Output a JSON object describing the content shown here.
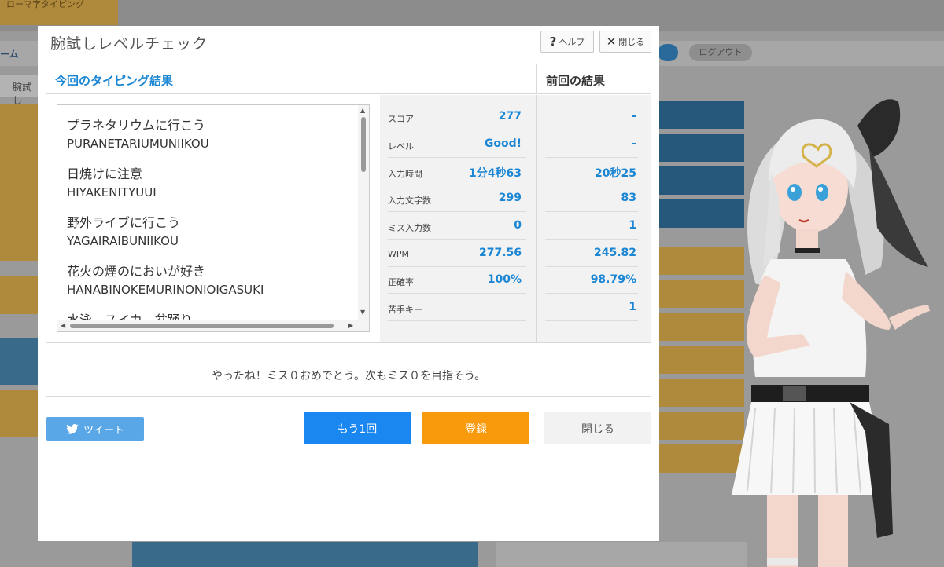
{
  "background": {
    "logo_text": "ローマ字タイピング",
    "nav_home": "ーム",
    "login": "ログアウト",
    "breadcrumb": "腕試し"
  },
  "dialog": {
    "title": "腕試しレベルチェック",
    "help_icon": "question-icon",
    "help_label": "ヘルプ",
    "close_icon": "x-icon",
    "close_label": "閉じる"
  },
  "tabs": {
    "current": "今回のタイピング結果",
    "previous": "前回の結果"
  },
  "words": [
    {
      "jp": "プラネタリウムに行こう",
      "romaji": "PURANETARIUMUNIIKOU"
    },
    {
      "jp": "日焼けに注意",
      "romaji": "HIYAKENITYUUI"
    },
    {
      "jp": "野外ライブに行こう",
      "romaji": "YAGAIRAIBUNIIKOU"
    },
    {
      "jp": "花火の煙のにおいが好き",
      "romaji": "HANABINOKEMURINONIOIGASUKI"
    },
    {
      "jp": "水泳、スイカ、盆踊り",
      "romaji": ""
    }
  ],
  "stats": [
    {
      "label": "スコア",
      "value": "277",
      "previous": "-"
    },
    {
      "label": "レベル",
      "value": "Good!",
      "previous": "-"
    },
    {
      "label": "入力時間",
      "value": "1分4秒63",
      "previous": "20秒25"
    },
    {
      "label": "入力文字数",
      "value": "299",
      "previous": "83"
    },
    {
      "label": "ミス入力数",
      "value": "0",
      "previous": "1"
    },
    {
      "label": "WPM",
      "value": "277.56",
      "previous": "245.82"
    },
    {
      "label": "正確率",
      "value": "100%",
      "previous": "98.79%"
    },
    {
      "label": "苦手キー",
      "value": "",
      "previous": "1"
    }
  ],
  "message": "やったね！ミス０おめでとう。次もミス０を目指そう。",
  "buttons": {
    "tweet": "ツイート",
    "again": "もう1回",
    "register": "登録",
    "close": "閉じる"
  },
  "colors": {
    "accent": "#1a86d4",
    "again": "#1a86f0",
    "register": "#f89a0c",
    "tweet": "#5aa7e8"
  }
}
